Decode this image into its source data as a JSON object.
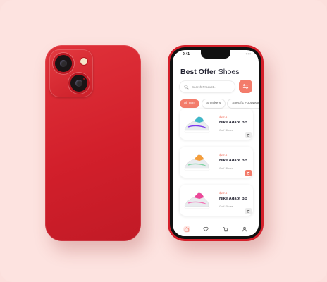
{
  "screen": {
    "status": {
      "time": "9:41",
      "signal": "▪▪▪"
    },
    "title": {
      "bold": "Best Offer",
      "rest": "Shoes"
    },
    "search": {
      "placeholder": "Search Product..."
    },
    "chips": [
      "All Item",
      "Sneakers",
      "Specific Footwear"
    ],
    "products": [
      {
        "price": "$29.47",
        "name": "Nike Adapt BB",
        "category": "Golf Shoes",
        "shoe_colors": [
          "#3fb8c9",
          "#e9ecef",
          "#7c3aed"
        ],
        "selected": false
      },
      {
        "price": "$29.47",
        "name": "Nike Adapt BB",
        "category": "Golf Shoes",
        "shoe_colors": [
          "#f59e3b",
          "#e9ecef",
          "#7dd3a1"
        ],
        "selected": true
      },
      {
        "price": "$29.47",
        "name": "Nike Adapt BB",
        "category": "Golf Shoes",
        "shoe_colors": [
          "#ec4899",
          "#e9ecef",
          "#f472b6"
        ],
        "selected": false
      }
    ],
    "nav": [
      "home-icon",
      "heart-icon",
      "cart-icon",
      "profile-icon"
    ]
  },
  "colors": {
    "accent": "#f37c6b",
    "phone_red": "#d21f2b",
    "background": "#fde3e0"
  }
}
